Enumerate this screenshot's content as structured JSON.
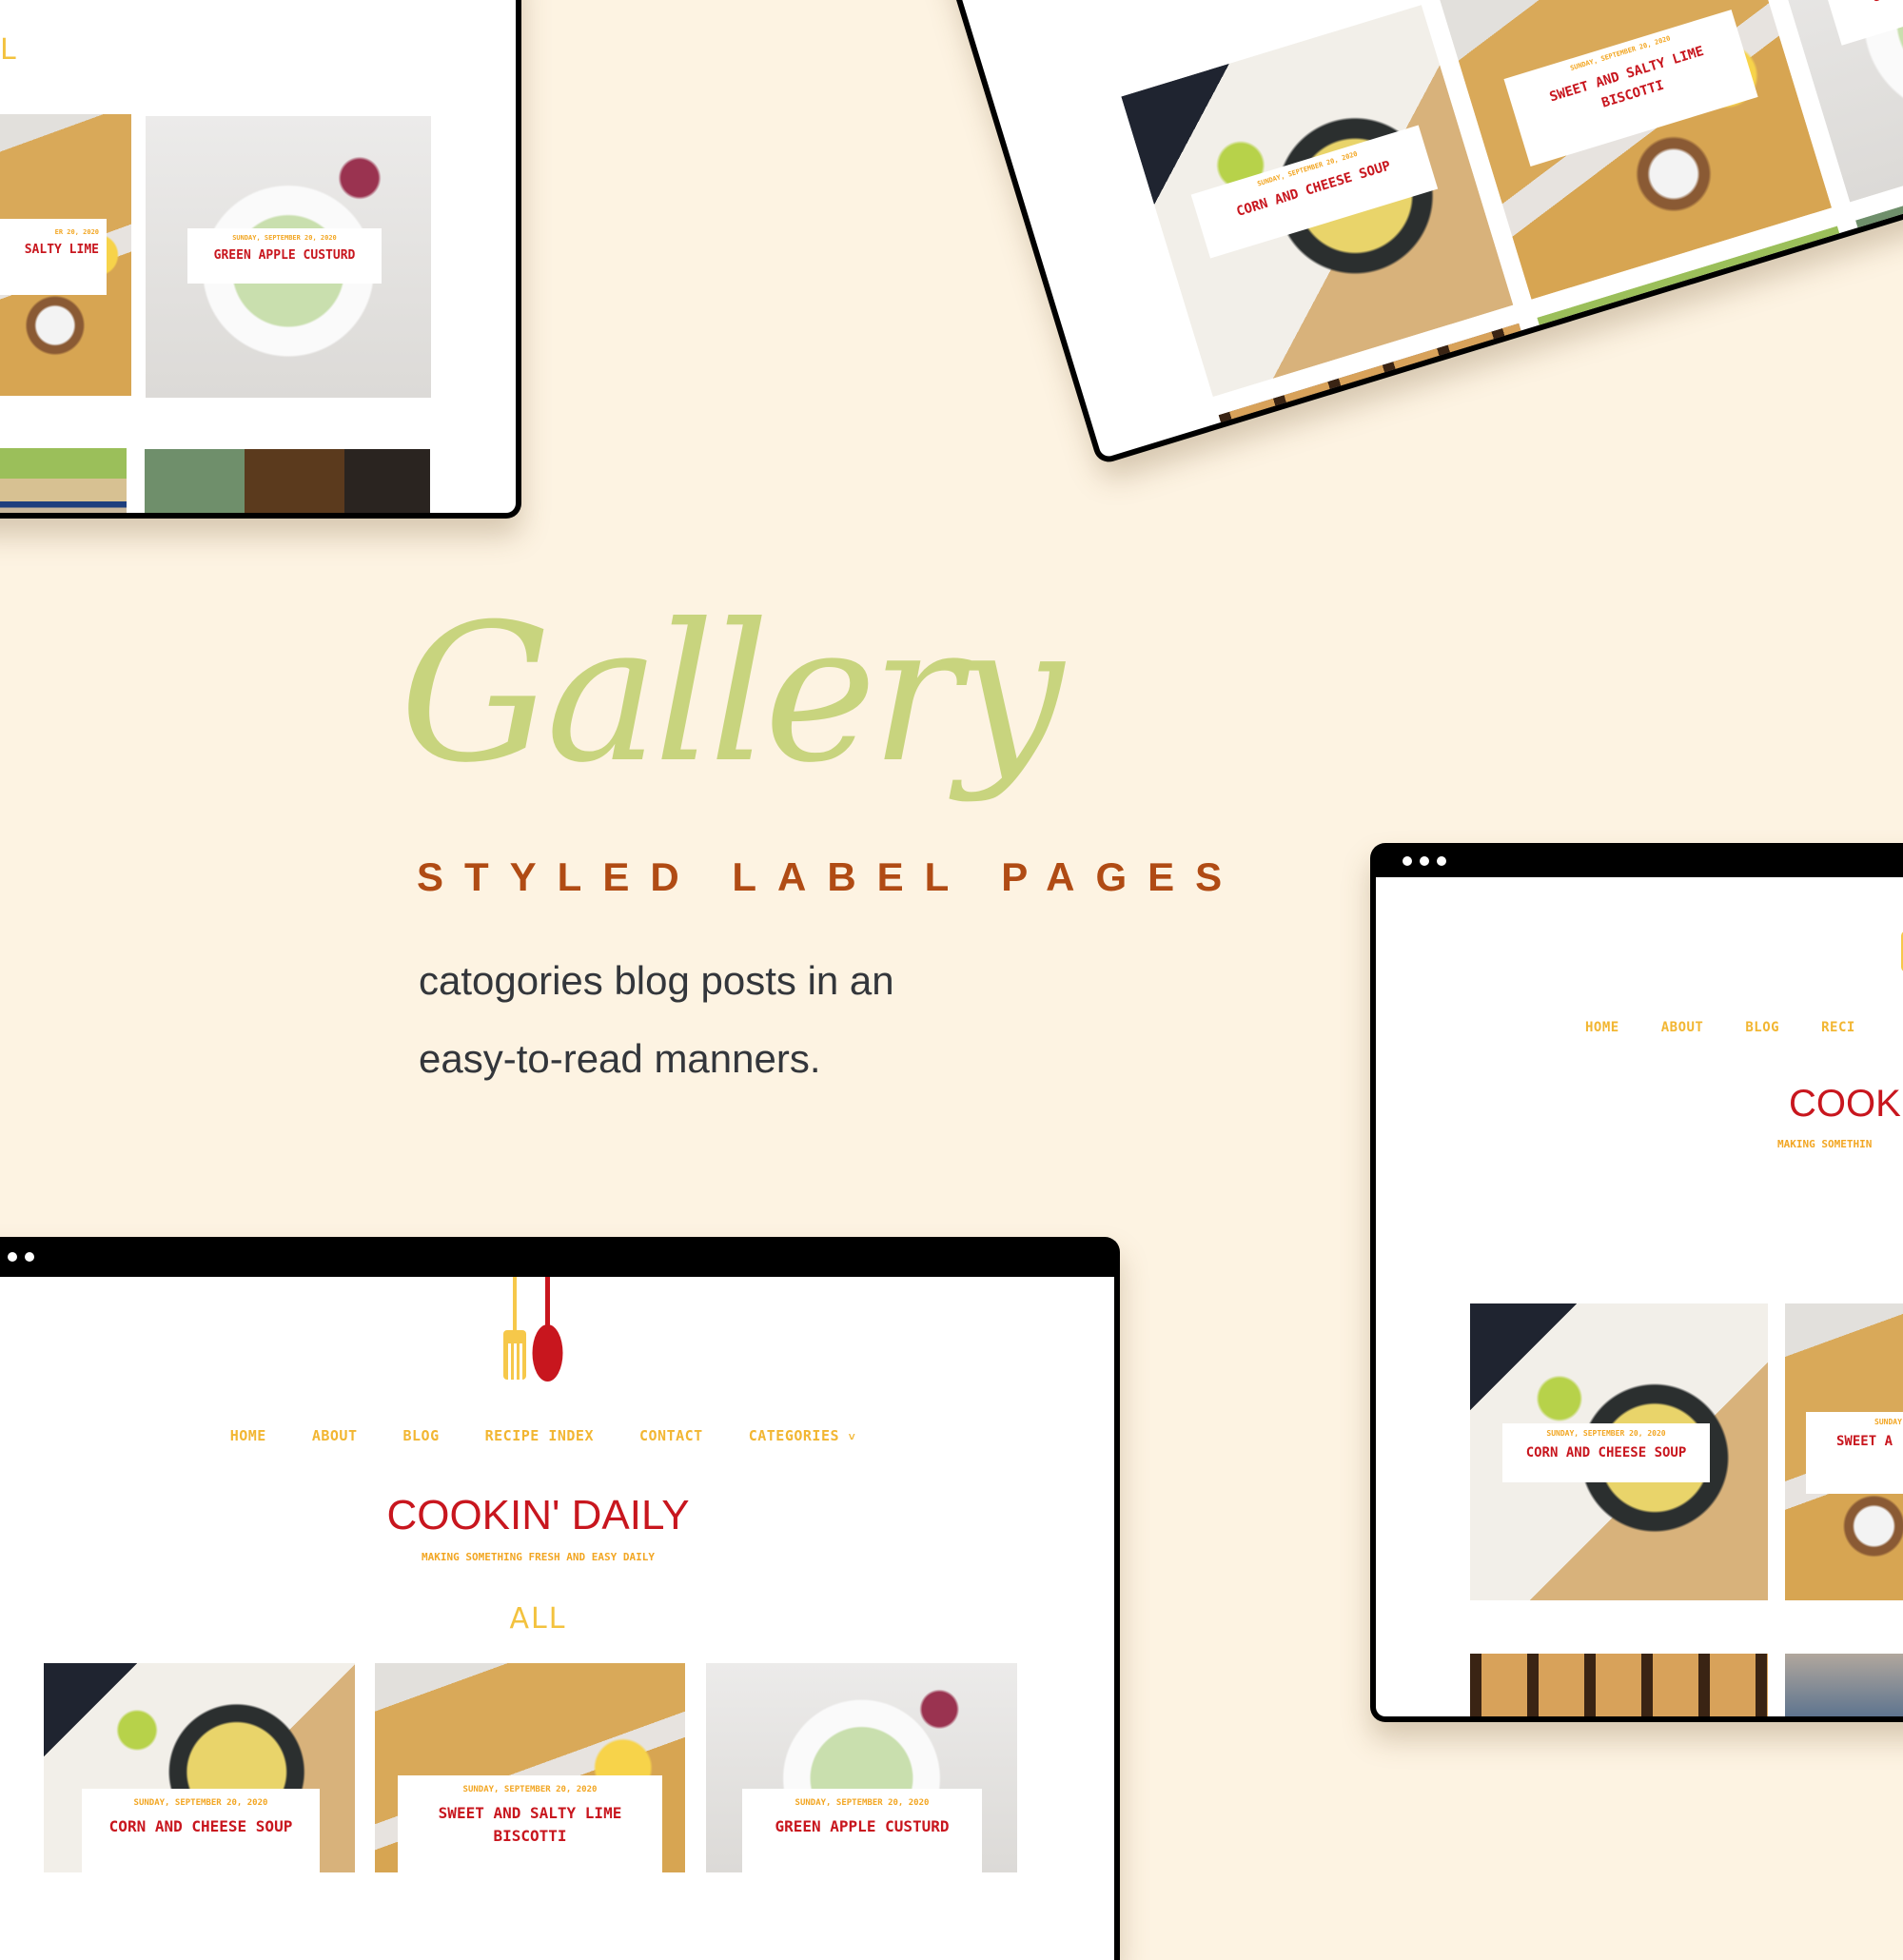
{
  "hero": {
    "title": "Gallery",
    "subtitle": "STYLED LABEL PAGES",
    "description": "catogories blog posts in an easy-to-read manners."
  },
  "colors": {
    "background": "#fdf3e2",
    "title_green": "#c8d47e",
    "subtitle_rust": "#b04b14",
    "blog_red": "#c8161e",
    "blog_yellow": "#f2b632"
  },
  "blog": {
    "name": "COOKIN' DAILY",
    "tagline": "MAKING SOMETHING FRESH AND EASY DAILY",
    "label_heading": "ALL",
    "nav": [
      {
        "label": "HOME"
      },
      {
        "label": "ABOUT"
      },
      {
        "label": "BLOG"
      },
      {
        "label": "RECIPE INDEX"
      },
      {
        "label": "CONTACT"
      },
      {
        "label": "CATEGORIES",
        "icon": "chevron-down-icon",
        "glyph": "˅"
      }
    ],
    "posts": [
      {
        "date": "SUNDAY, SEPTEMBER 20, 2020",
        "title": "CORN AND CHEESE SOUP"
      },
      {
        "date": "SUNDAY, SEPTEMBER 20, 2020",
        "title": "SWEET AND SALTY LIME BISCOTTI"
      },
      {
        "date": "SUNDAY, SEPTEMBER 20, 2020",
        "title": "GREEN APPLE CUSTURD"
      }
    ],
    "partial_label": "L",
    "partial_post_title": "SALTY LIME",
    "partial_post_title_line2": "TTI",
    "partial_date": "ER 20, 2020",
    "partial_nav_item": "RECI",
    "partial_blog_name": "COOK",
    "partial_tagline": "MAKING SOMETHIN",
    "partial_post_title_right": "SWEET A",
    "partial_date_right": "SUNDAY,"
  }
}
